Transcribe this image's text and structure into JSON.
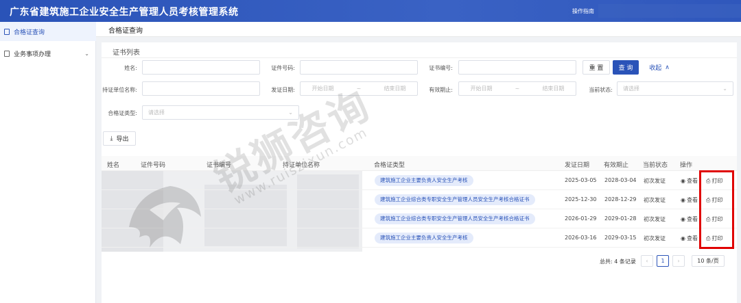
{
  "header": {
    "title": "广东省建筑施工企业安全生产管理人员考核管理系统",
    "guide_label": "操作指南"
  },
  "sidebar": {
    "items": [
      {
        "label": "合格证查询",
        "active": true
      },
      {
        "label": "业务事项办理",
        "chevron": "chevron-down"
      }
    ]
  },
  "breadcrumb": {
    "current": "合格证查询"
  },
  "card": {
    "title": "证书列表"
  },
  "filters": {
    "name_label": "姓名:",
    "id_label": "证件号码:",
    "cert_no_label": "证书编号:",
    "unit_label": "持证单位名称:",
    "issue_date_label": "发证日期:",
    "valid_label": "有效期止:",
    "status_label": "当前状态:",
    "type_label": "合格证类型:",
    "start_placeholder": "开始日期",
    "end_placeholder": "结束日期",
    "range_sep": "~",
    "select_placeholder": "请选择"
  },
  "buttons": {
    "reset": "重 置",
    "query": "查 询",
    "collapse": "收起",
    "export": "导出"
  },
  "table": {
    "columns": [
      "姓名",
      "证件号码",
      "证书编号",
      "持证单位名称",
      "合格证类型",
      "发证日期",
      "有效期止",
      "当前状态",
      "操作"
    ],
    "rows": [
      {
        "type": "建筑施工企业主要负责人安全生产考核",
        "issue": "2025-03-05",
        "valid": "2028-03-04",
        "status": "初次发证"
      },
      {
        "type": "建筑施工企业综合类专职安全生产管理人员安全生产考核合格证书",
        "issue": "2025-12-30",
        "valid": "2028-12-29",
        "status": "初次发证"
      },
      {
        "type": "建筑施工企业综合类专职安全生产管理人员安全生产考核合格证书",
        "issue": "2026-01-29",
        "valid": "2029-01-28",
        "status": "初次发证"
      },
      {
        "type": "建筑施工企业主要负责人安全生产考核",
        "issue": "2026-03-16",
        "valid": "2029-03-15",
        "status": "初次发证"
      }
    ],
    "view_label": "查看",
    "print_label": "打印"
  },
  "pagination": {
    "total_label": "总共: 4 条记录",
    "current_page": "1",
    "prev": "‹",
    "next": "›",
    "page_size": "10 条/页"
  },
  "watermark": {
    "text": "锐狮咨询",
    "url": "www.ruiszixun.com"
  },
  "colors": {
    "primary": "#2a53b8",
    "highlight_box": "#e00000",
    "tag_bg": "#e4ebfb"
  }
}
